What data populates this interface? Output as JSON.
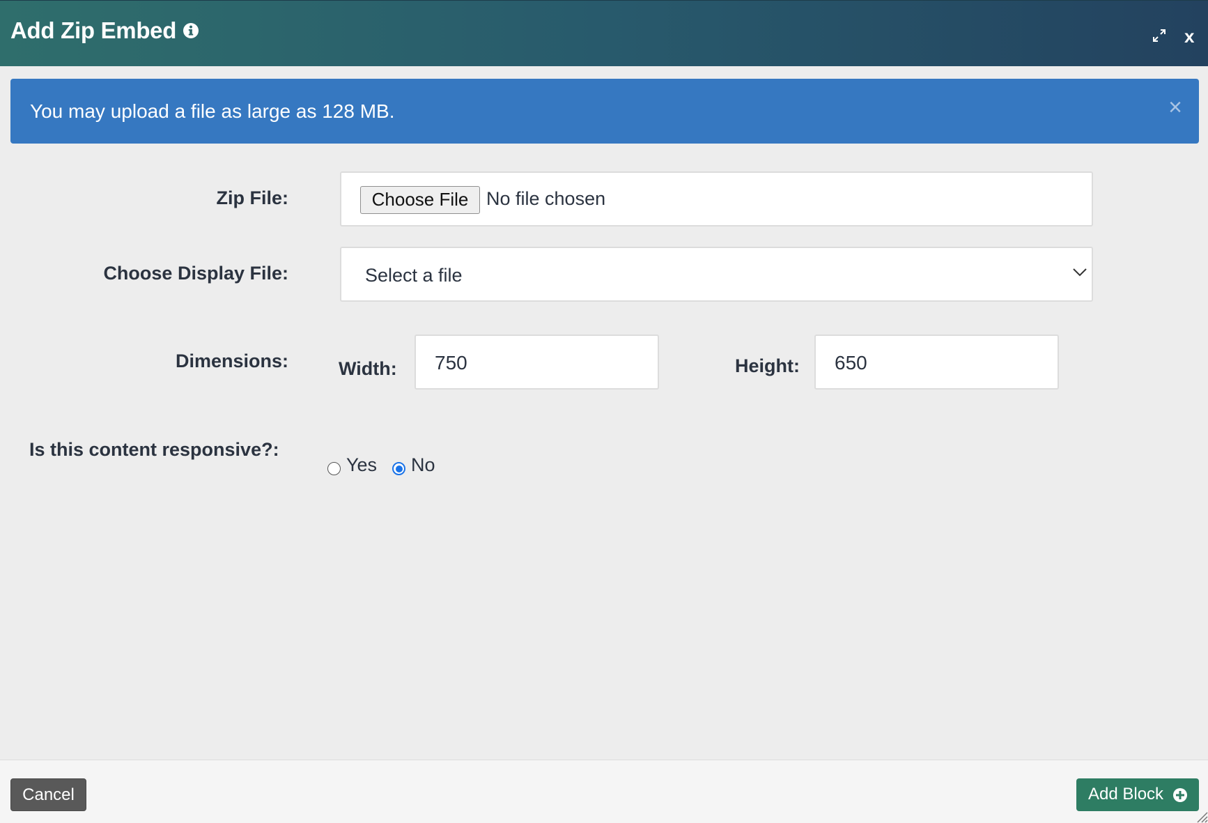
{
  "dialog": {
    "title": "Add Zip Embed",
    "close_label": "x"
  },
  "alert": {
    "message": "You may upload a file as large as 128 MB.",
    "close_label": "×"
  },
  "form": {
    "zip_file": {
      "label": "Zip File:",
      "button_label": "Choose File",
      "status": "No file chosen"
    },
    "display_file": {
      "label": "Choose Display File:",
      "selected": "Select a file"
    },
    "dimensions": {
      "label": "Dimensions:",
      "width_label": "Width:",
      "width_value": "750",
      "height_label": "Height:",
      "height_value": "650"
    },
    "responsive": {
      "label": "Is this content responsive?:",
      "options": [
        {
          "label": "Yes",
          "selected": false
        },
        {
          "label": "No",
          "selected": true
        }
      ]
    }
  },
  "footer": {
    "cancel_label": "Cancel",
    "add_label": "Add Block"
  },
  "colors": {
    "header_start": "#2f6e6c",
    "header_end": "#23425f",
    "alert_bg": "#3678c1",
    "add_button": "#2e7d63",
    "cancel_button": "#595959"
  },
  "icons": [
    "info-icon",
    "expand-icon",
    "close-icon",
    "chevron-down-icon",
    "plus-circle-icon",
    "resize-grip-icon"
  ]
}
